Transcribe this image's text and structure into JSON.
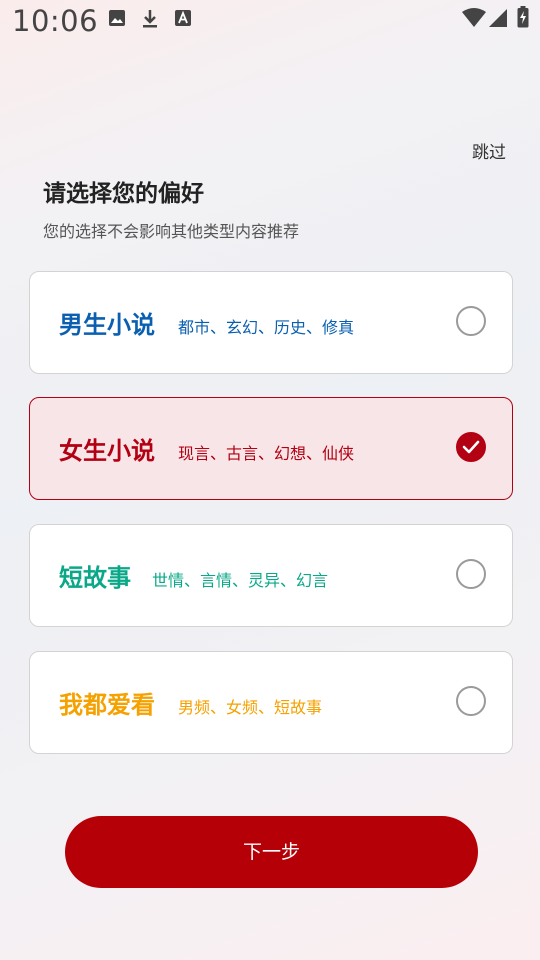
{
  "status_bar": {
    "time": "10:06",
    "icons": [
      "image-icon",
      "download-icon",
      "font-a-icon",
      "wifi-icon",
      "signal-icon",
      "battery-charging-icon"
    ]
  },
  "header": {
    "skip_label": "跳过",
    "title": "请选择您的偏好",
    "subtitle": "您的选择不会影响其他类型内容推荐"
  },
  "options": [
    {
      "title": "男生小说",
      "tags": "都市、玄幻、历史、修真",
      "color": "#0a5fb0",
      "selected": false
    },
    {
      "title": "女生小说",
      "tags": "现言、古言、幻想、仙侠",
      "color": "#b30012",
      "selected": true
    },
    {
      "title": "短故事",
      "tags": "世情、言情、灵异、幻言",
      "color": "#0aa889",
      "selected": false
    },
    {
      "title": "我都爱看",
      "tags": "男频、女频、短故事",
      "color": "#f5a100",
      "selected": false
    }
  ],
  "footer": {
    "next_label": "下一步"
  },
  "colors": {
    "accent": "#b40006"
  }
}
